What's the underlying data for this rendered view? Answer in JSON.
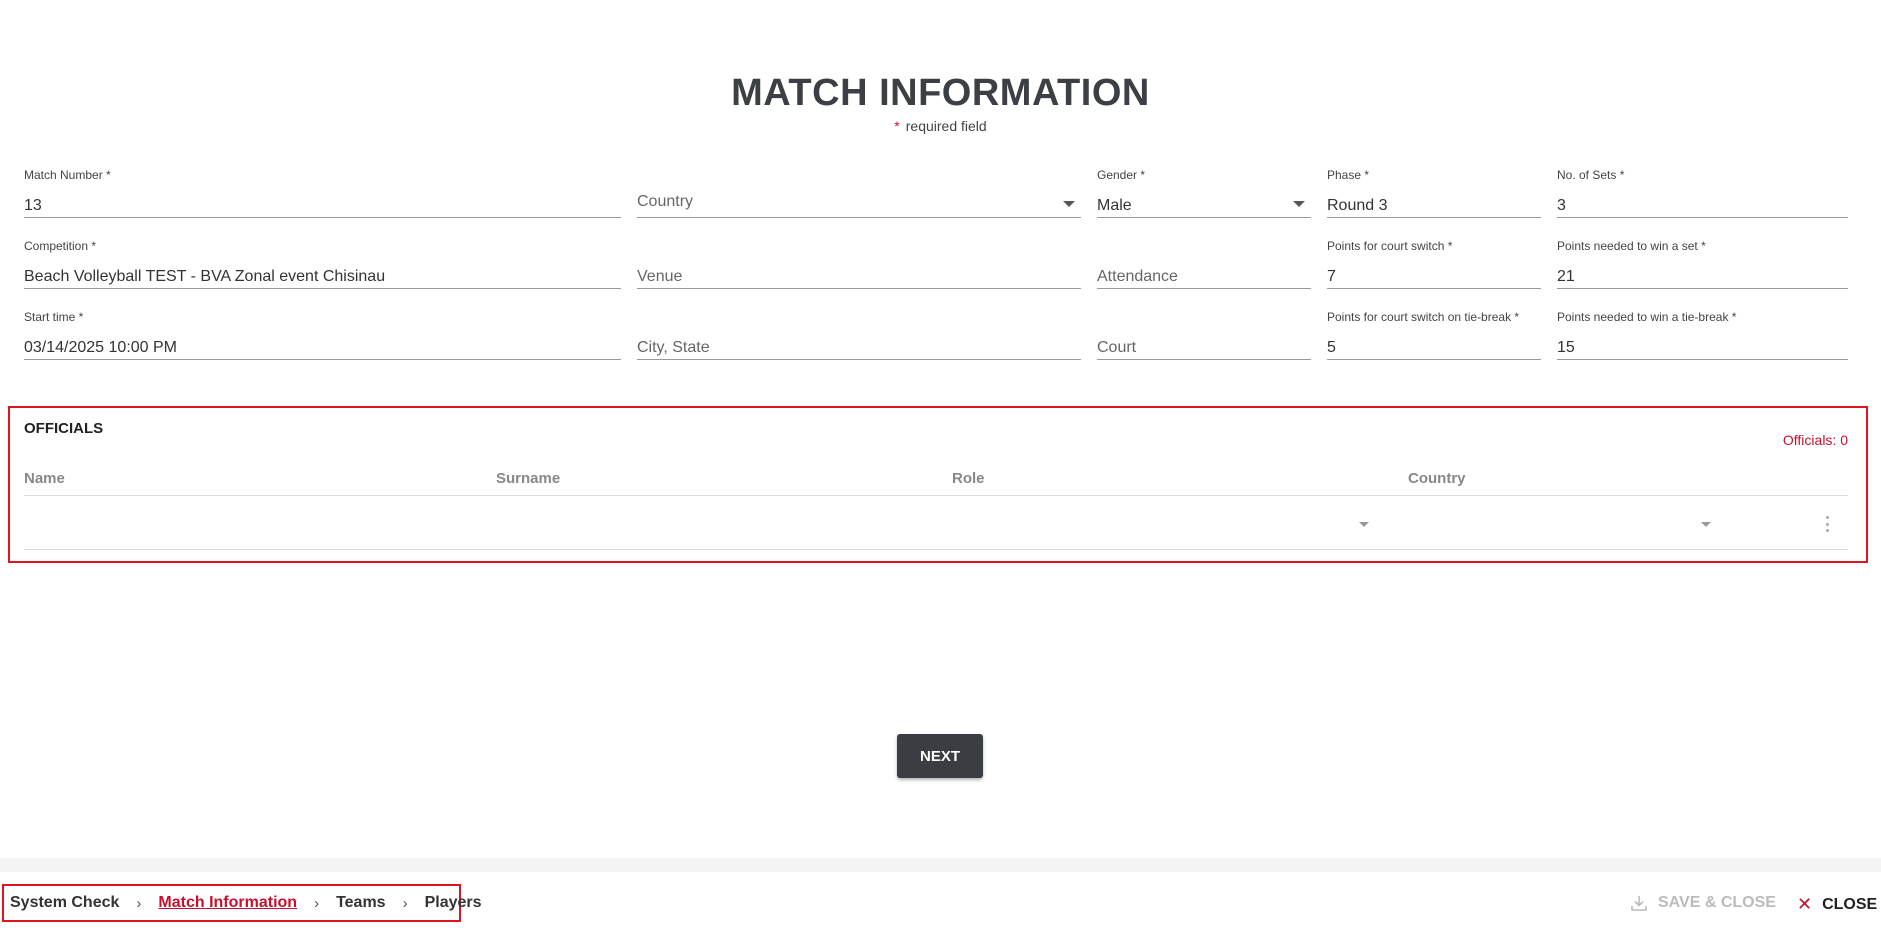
{
  "header": {
    "title": "MATCH INFORMATION",
    "required_star": "*",
    "required_note": "required field"
  },
  "form": {
    "match_number": {
      "label": "Match Number *",
      "value": "13"
    },
    "country": {
      "placeholder": "Country"
    },
    "gender": {
      "label": "Gender *",
      "value": "Male"
    },
    "phase": {
      "label": "Phase *",
      "value": "Round 3"
    },
    "no_of_sets": {
      "label": "No. of Sets *",
      "value": "3"
    },
    "competition": {
      "label": "Competition *",
      "value": "Beach Volleyball TEST - BVA Zonal event Chisinau"
    },
    "venue": {
      "placeholder": "Venue"
    },
    "attendance": {
      "placeholder": "Attendance"
    },
    "points_court_switch": {
      "label": "Points for court switch *",
      "value": "7"
    },
    "points_win_set": {
      "label": "Points needed to win a set *",
      "value": "21"
    },
    "start_time": {
      "label": "Start time *",
      "value": "03/14/2025 10:00 PM"
    },
    "city_state": {
      "placeholder": "City, State"
    },
    "court": {
      "placeholder": "Court"
    },
    "points_court_switch_tiebreak": {
      "label": "Points for court switch on tie-break *",
      "value": "5"
    },
    "points_win_tiebreak": {
      "label": "Points needed to win a tie-break *",
      "value": "15"
    }
  },
  "officials": {
    "title": "OFFICIALS",
    "count_label": "Officials: 0",
    "columns": [
      "Name",
      "Surname",
      "Role",
      "Country"
    ]
  },
  "actions": {
    "next_label": "NEXT"
  },
  "footer": {
    "breadcrumbs": [
      "System Check",
      "Match Information",
      "Teams",
      "Players"
    ],
    "active_step": "Match Information",
    "save_close_label": "SAVE & CLOSE",
    "close_label": "CLOSE"
  },
  "colors": {
    "accent": "#c8102e",
    "highlight_border": "#e0141e",
    "button_bg": "#3a3d42",
    "disabled_text": "#bbbbbb"
  },
  "icons": {
    "dropdown": "chevron-down-icon",
    "row_menu": "more-vert-icon",
    "breadcrumb_separator": "chevron-right-icon",
    "save": "download-icon",
    "close": "close-icon"
  }
}
